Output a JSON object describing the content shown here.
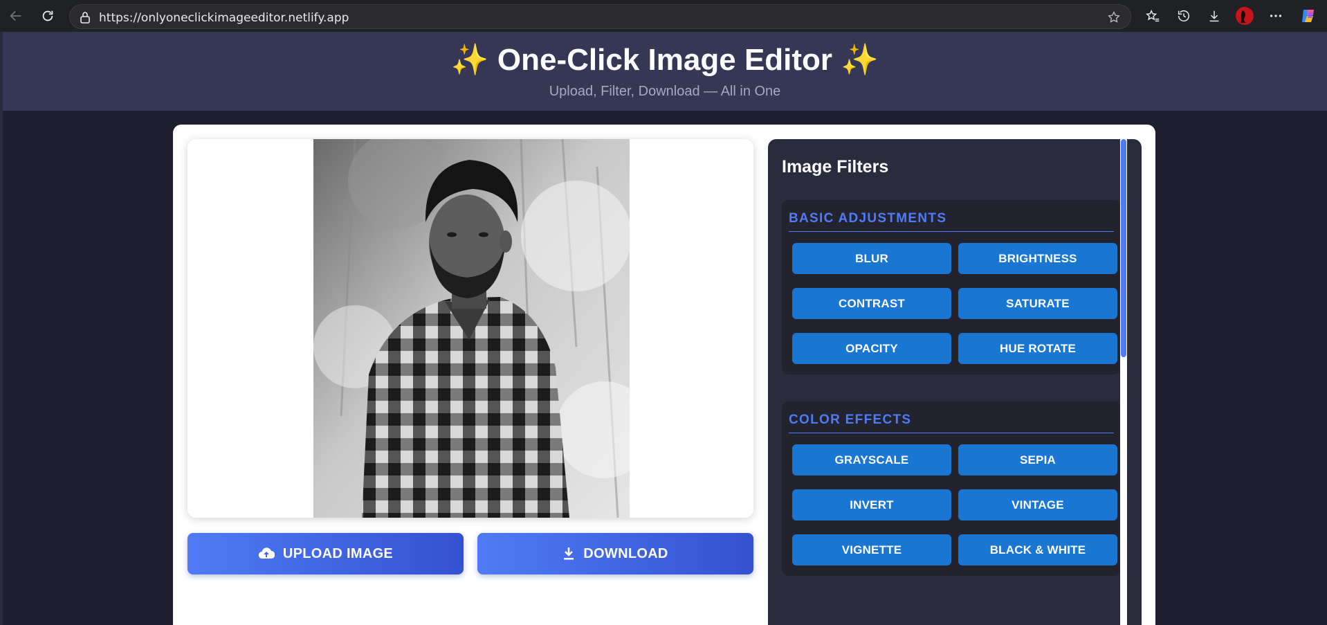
{
  "browser": {
    "url": "https://onlyoneclickimageeditor.netlify.app"
  },
  "header": {
    "title": "✨ One-Click Image Editor ✨",
    "subtitle": "Upload, Filter, Download — All in One"
  },
  "actions": {
    "upload_label": "UPLOAD IMAGE",
    "download_label": "DOWNLOAD"
  },
  "filters": {
    "title": "Image Filters",
    "groups": [
      {
        "title": "BASIC ADJUSTMENTS",
        "buttons": [
          "BLUR",
          "BRIGHTNESS",
          "CONTRAST",
          "SATURATE",
          "OPACITY",
          "HUE ROTATE"
        ]
      },
      {
        "title": "COLOR EFFECTS",
        "buttons": [
          "GRAYSCALE",
          "SEPIA",
          "INVERT",
          "VINTAGE",
          "VIGNETTE",
          "BLACK & WHITE"
        ]
      }
    ]
  },
  "colors": {
    "accent": "#4f7bf6",
    "filter_button": "#1976d2",
    "header_bg": "#363655",
    "page_bg": "#1e1e2e"
  }
}
